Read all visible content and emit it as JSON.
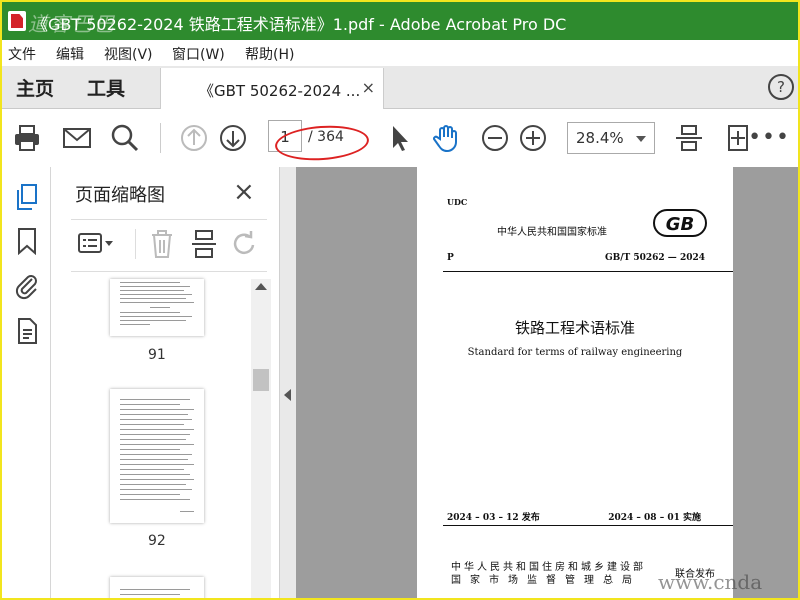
{
  "window": {
    "title": "《GBT 50262-2024 铁路工程术语标准》1.pdf - Adobe Acrobat Pro DC",
    "watermark": "道客巴巴"
  },
  "menu": [
    "文件",
    "编辑",
    "视图(V)",
    "窗口(W)",
    "帮助(H)"
  ],
  "tabs": {
    "home": "主页",
    "tools": "工具",
    "document": "《GBT 50262-2024 ...",
    "close": "×",
    "help": "?"
  },
  "toolbar": {
    "page_current": "1",
    "page_total": "/ 364",
    "zoom": "28.4%",
    "more": "•••"
  },
  "thumbnail_panel": {
    "title": "页面缩略图",
    "close": "×",
    "pages": [
      "91",
      "92"
    ]
  },
  "document_page": {
    "udc": "UDC",
    "national_standard": "中华人民共和国国家标准",
    "gb_mark": "GB",
    "classification": "P",
    "code": "GB/T 50262 — 2024",
    "title_cn": "铁路工程术语标准",
    "title_en": "Standard for terms of railway engineering",
    "issued": "2024 – 03 – 12  发布",
    "implemented": "2024 – 08 – 01  实施",
    "publisher_1": "中华人民共和国住房和城乡建设部",
    "publisher_2": "国家市场监督管理总局",
    "joint_issue": "联合发布"
  },
  "site_watermark": "www.cnda"
}
